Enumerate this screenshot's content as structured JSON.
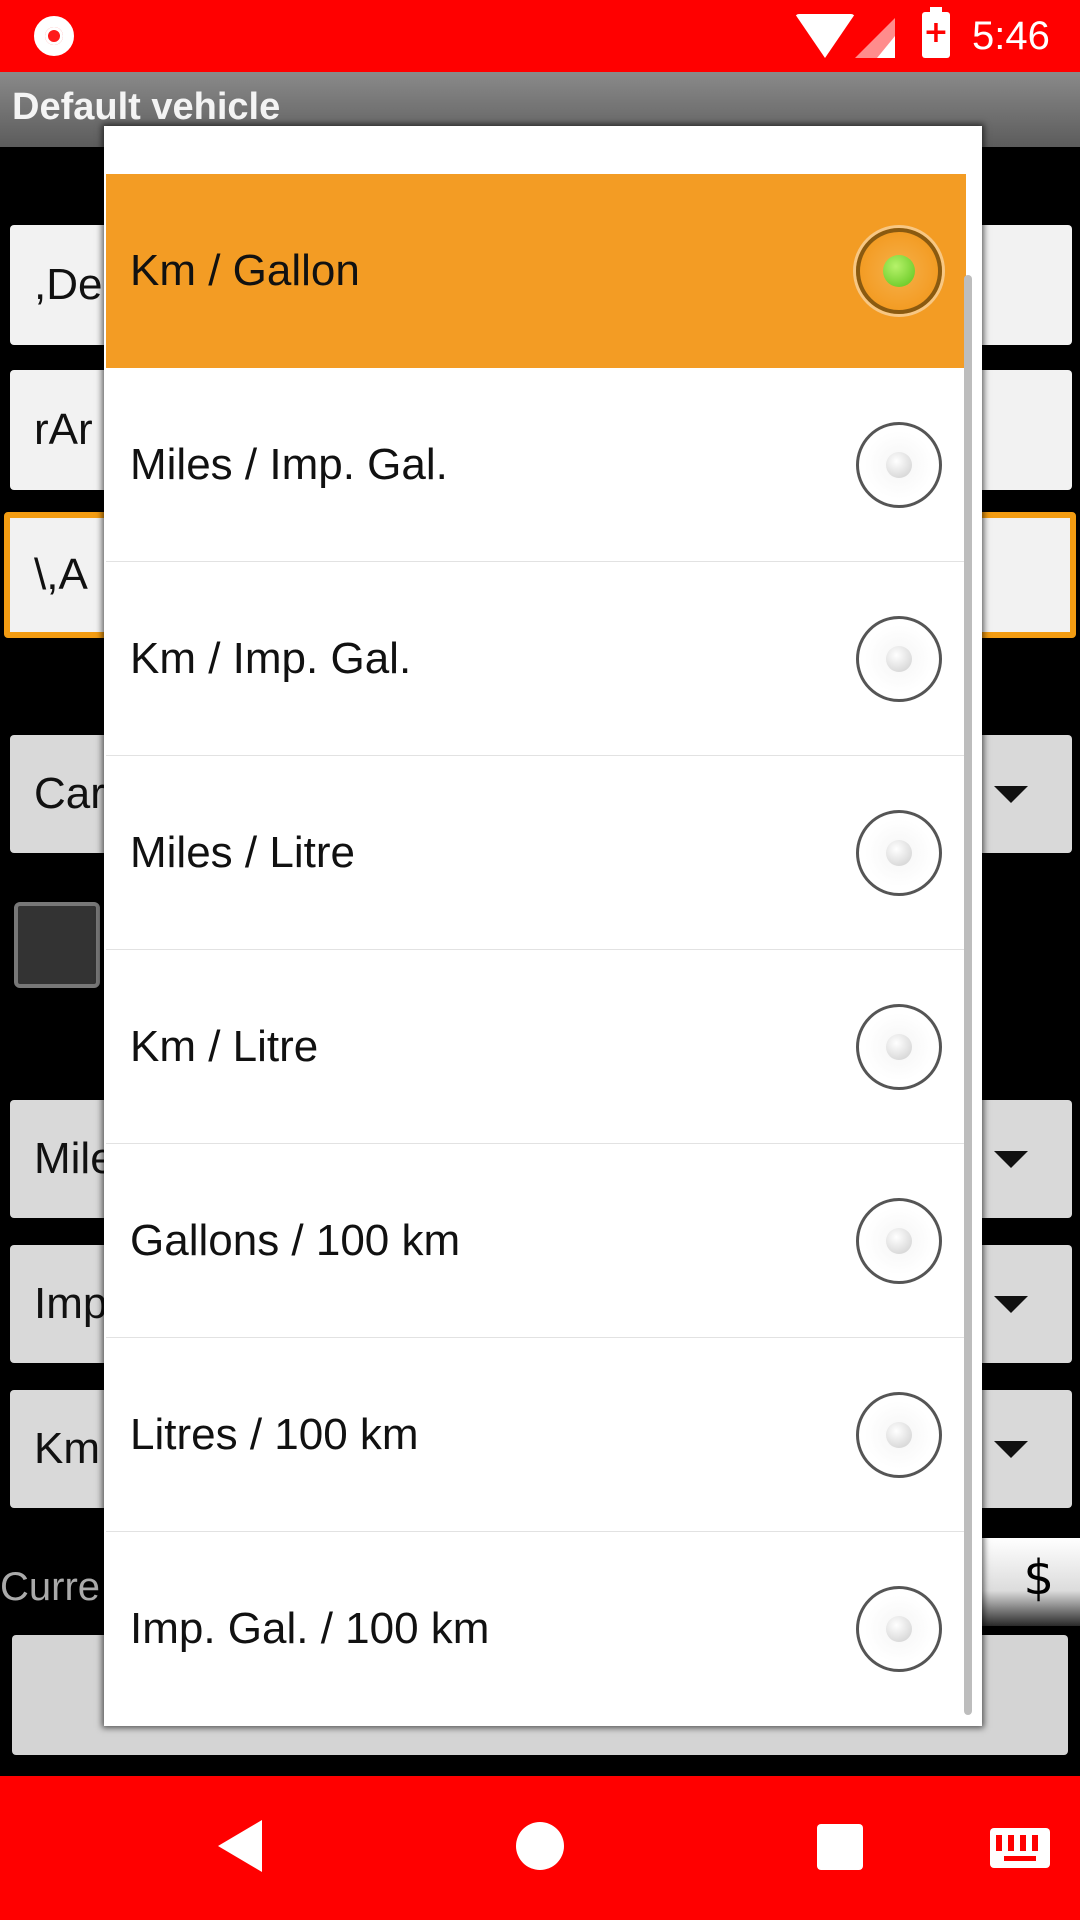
{
  "status_bar": {
    "time": "5:46"
  },
  "title_bar": {
    "title": "Default vehicle"
  },
  "background_form": {
    "field_1": ",De",
    "field_2": "rAr",
    "field_3": "\\,A",
    "spinner_1": "Car",
    "spinner_2": "Mile",
    "spinner_3": "Imp",
    "spinner_4": "Km",
    "currency_label": "Curre",
    "currency_value": "$"
  },
  "dialog": {
    "options": [
      {
        "label": "Km / Gallon",
        "selected": true
      },
      {
        "label": "Miles / Imp. Gal.",
        "selected": false
      },
      {
        "label": "Km / Imp. Gal.",
        "selected": false
      },
      {
        "label": "Miles / Litre",
        "selected": false
      },
      {
        "label": "Km / Litre",
        "selected": false
      },
      {
        "label": "Gallons / 100 km",
        "selected": false
      },
      {
        "label": "Litres / 100 km",
        "selected": false
      },
      {
        "label": "Imp. Gal. / 100 km",
        "selected": false
      }
    ]
  },
  "colors": {
    "status_bar": "#ff0000",
    "accent": "#f39c24",
    "selected_dot": "#5cc21a"
  },
  "icons": [
    "record-icon",
    "wifi-icon",
    "signal-icon",
    "battery-charging-icon",
    "back-icon",
    "home-icon",
    "recents-icon",
    "keyboard-icon"
  ]
}
